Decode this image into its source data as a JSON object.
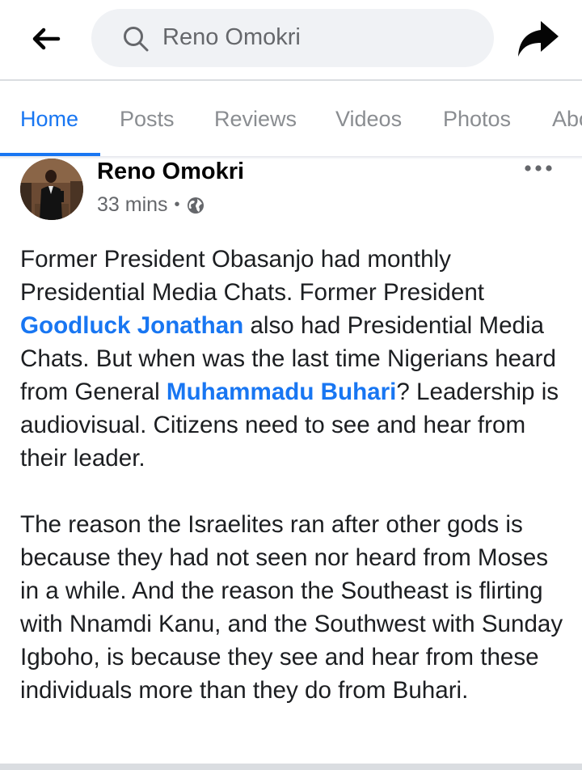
{
  "search": {
    "value": "Reno Omokri"
  },
  "tabs": [
    {
      "label": "Home"
    },
    {
      "label": "Posts"
    },
    {
      "label": "Reviews"
    },
    {
      "label": "Videos"
    },
    {
      "label": "Photos"
    },
    {
      "label": "Abo"
    }
  ],
  "post": {
    "author": "Reno Omokri",
    "time": "33 mins",
    "separator": "•",
    "privacy_icon": "globe-icon",
    "p1": {
      "t1": "Former President Obasanjo had monthly Presidential Media Chats. Former President ",
      "m1": "Goodluck Jonathan",
      "t2": " also had Presidential Media Chats. But when was the last time Nigerians heard from General ",
      "m2": "Muhammadu Buhari",
      "t3": "? Leadership is audiovisual. Citizens need to see and hear from their leader."
    },
    "p2": "The reason the Israelites ran after other gods is because they had not seen nor heard from Moses in a while. And the reason the Southeast is flirting with Nnamdi Kanu, and the Southwest with Sunday Igboho, is because they see and hear from these individuals more than they do from Buhari."
  },
  "icons": {
    "back": "arrow-left-icon",
    "search": "search-icon",
    "share": "share-arrow-icon",
    "more": "more-dots-icon"
  },
  "colors": {
    "accent": "#1876f2",
    "search_bg": "#f0f2f5",
    "muted_text": "#65676b",
    "tab_inactive": "#8a8d91"
  }
}
